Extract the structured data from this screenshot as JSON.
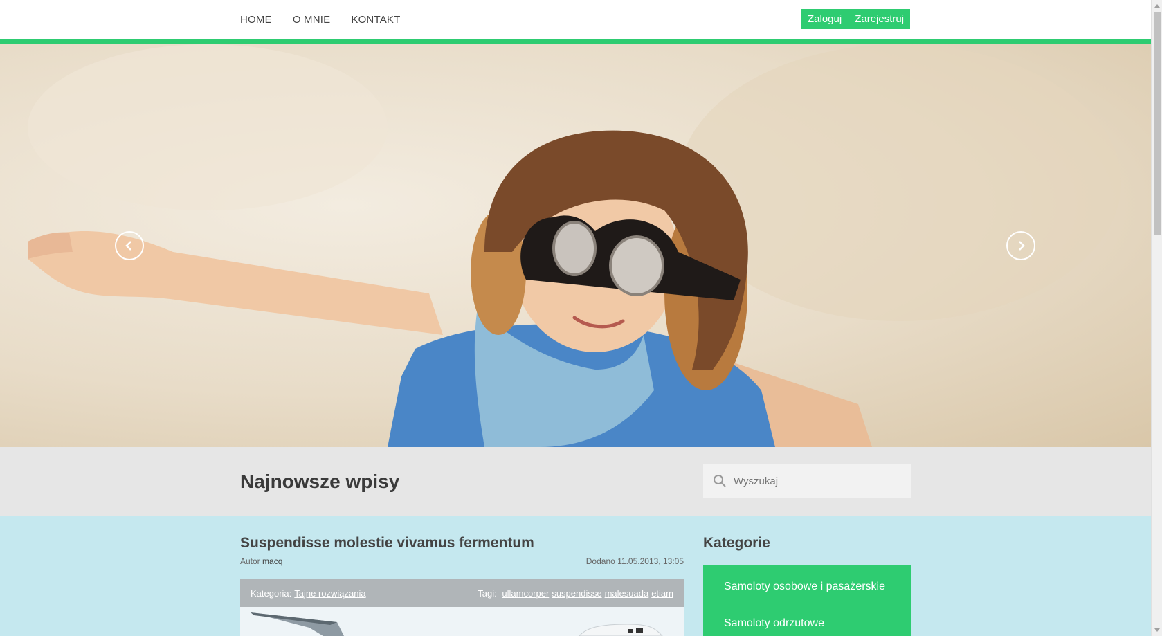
{
  "nav": {
    "items": [
      {
        "label": "HOME",
        "active": true
      },
      {
        "label": "O MNIE"
      },
      {
        "label": "KONTAKT"
      }
    ],
    "login_label": "Zaloguj",
    "register_label": "Zarejestruj"
  },
  "colors": {
    "accent": "#2ecc71",
    "band": "#e6e6e6",
    "content_bg": "#c5e8ef"
  },
  "hero": {
    "prev_icon": "chevron-left-icon",
    "next_icon": "chevron-right-icon"
  },
  "header": {
    "title": "Najnowsze wpisy",
    "search_placeholder": "Wyszukaj"
  },
  "post": {
    "title": "Suspendisse molestie vivamus fermentum",
    "author_label": "Autor",
    "author": "macq",
    "date_label": "Dodano 11.05.2013, 13:05",
    "category_label": "Kategoria:",
    "category": "Tajne rozwiązania",
    "tags_label": "Tagi:",
    "tags": [
      "ullamcorper",
      "suspendisse",
      "malesuada",
      "etiam"
    ]
  },
  "sidebar": {
    "title": "Kategorie",
    "categories": [
      "Samoloty osobowe i pasażerskie",
      "Samoloty odrzutowe"
    ]
  }
}
